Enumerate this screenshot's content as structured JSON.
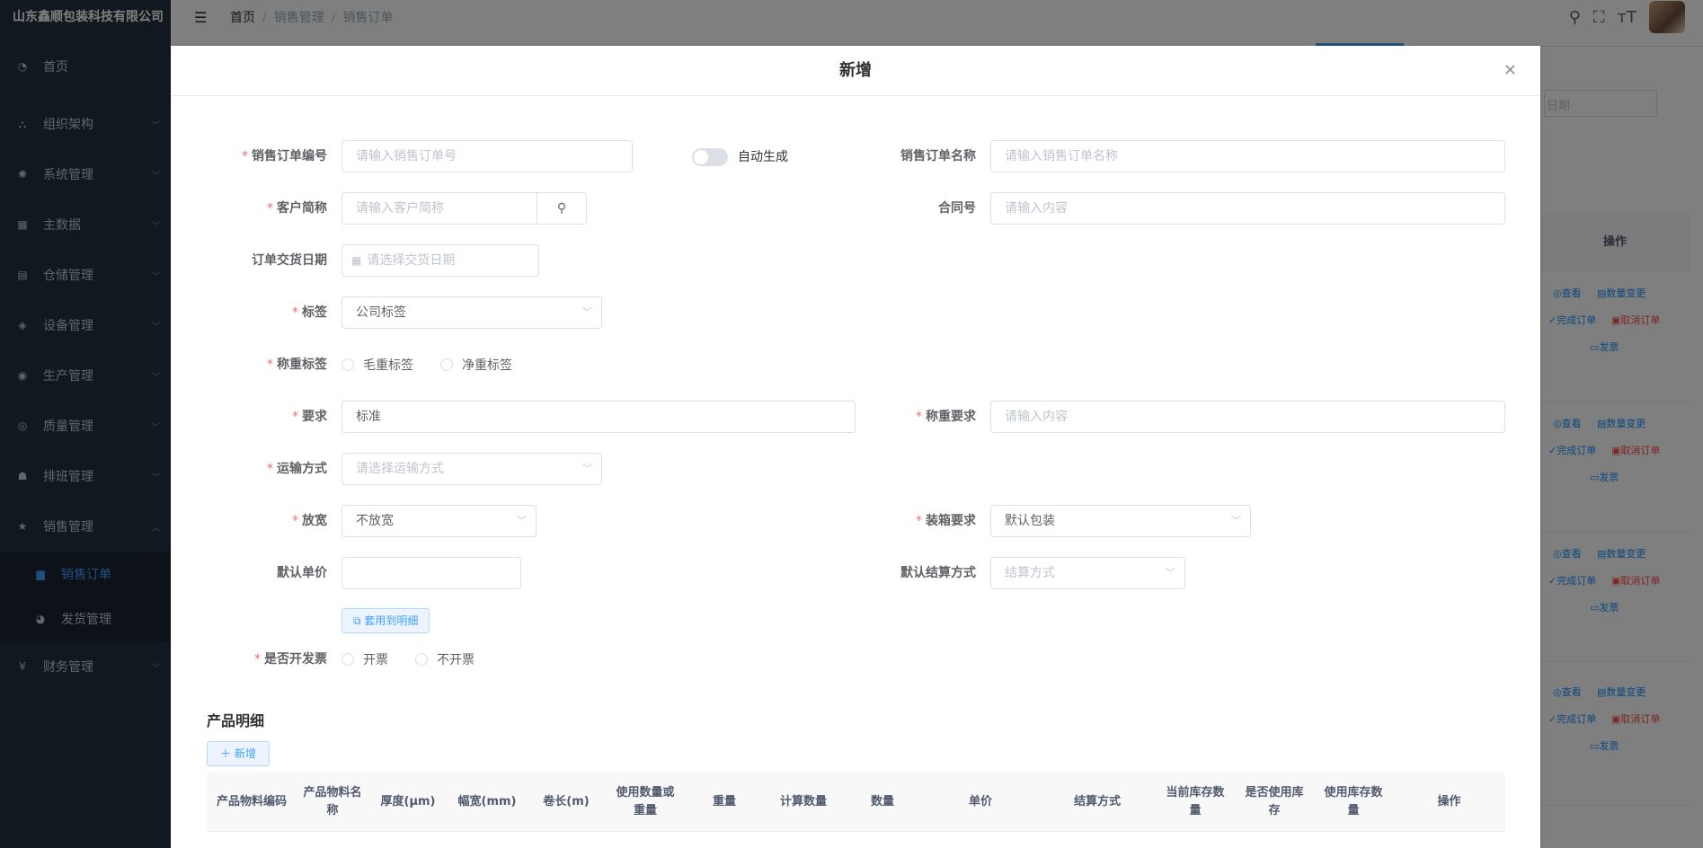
{
  "sidebar": {
    "company": "山东鑫顺包装科技有限公司",
    "items": [
      {
        "label": "首页",
        "icon": "dashboard-icon"
      },
      {
        "label": "组织架构",
        "icon": "org-tree-icon"
      },
      {
        "label": "系统管理",
        "icon": "gear-icon"
      },
      {
        "label": "主数据",
        "icon": "grid-icon"
      },
      {
        "label": "仓储管理",
        "icon": "warehouse-icon"
      },
      {
        "label": "设备管理",
        "icon": "layers-icon"
      },
      {
        "label": "生产管理",
        "icon": "eye-icon"
      },
      {
        "label": "质量管理",
        "icon": "quality-icon"
      },
      {
        "label": "排班管理",
        "icon": "people-icon"
      },
      {
        "label": "销售管理",
        "icon": "star-icon"
      }
    ],
    "sub_items": [
      {
        "label": "销售订单",
        "icon": "document-icon"
      },
      {
        "label": "发货管理",
        "icon": "globe-icon"
      }
    ],
    "last_item": {
      "label": "财务管理",
      "icon": "yen-icon"
    }
  },
  "topbar": {
    "crumb_home": "首页",
    "crumb_mid": "销售管理",
    "crumb_current": "销售订单"
  },
  "background": {
    "date_placeholder": "日期",
    "op_header": "操作",
    "actions": {
      "view": "◎查看",
      "qty_change": "▤数量变更",
      "complete": "✓完成订单",
      "cancel": "▣取消订单",
      "invoice": "▭发票"
    }
  },
  "dialog": {
    "title": "新增",
    "fields": {
      "order_no_label": "销售订单编号",
      "order_no_placeholder": "请输入销售订单号",
      "auto_gen_label": "自动生成",
      "order_name_label": "销售订单名称",
      "order_name_placeholder": "请输入销售订单名称",
      "customer_label": "客户简称",
      "customer_placeholder": "请输入客户简称",
      "contract_label": "合同号",
      "contract_placeholder": "请输入内容",
      "delivery_date_label": "订单交货日期",
      "delivery_date_placeholder": "请选择交货日期",
      "tag_label": "标签",
      "tag_value": "公司标签",
      "weigh_tag_label": "称重标签",
      "weigh_tag_options": [
        "毛重标签",
        "净重标签"
      ],
      "require_label": "要求",
      "require_value": "标准",
      "weigh_require_label": "称重要求",
      "weigh_require_placeholder": "请输入内容",
      "transport_label": "运输方式",
      "transport_placeholder": "请选择运输方式",
      "widen_label": "放宽",
      "widen_value": "不放宽",
      "packing_label": "装箱要求",
      "packing_value": "默认包装",
      "unit_price_label": "默认单价",
      "unit_price_value": "",
      "settle_label": "默认结算方式",
      "settle_placeholder": "结算方式",
      "apply_btn": "套用到明细",
      "invoice_label": "是否开发票",
      "invoice_options": [
        "开票",
        "不开票"
      ]
    },
    "detail": {
      "title": "产品明细",
      "add_btn": "＋ 新增",
      "columns": [
        "产品物料编码",
        "产品物料名称",
        "厚度(μm)",
        "幅宽(mm)",
        "卷长(m)",
        "使用数量或重量",
        "重量",
        "计算数量",
        "数量",
        "单价",
        "结算方式",
        "当前库存数量",
        "是否使用库存",
        "使用库存数量",
        "操作"
      ]
    }
  }
}
